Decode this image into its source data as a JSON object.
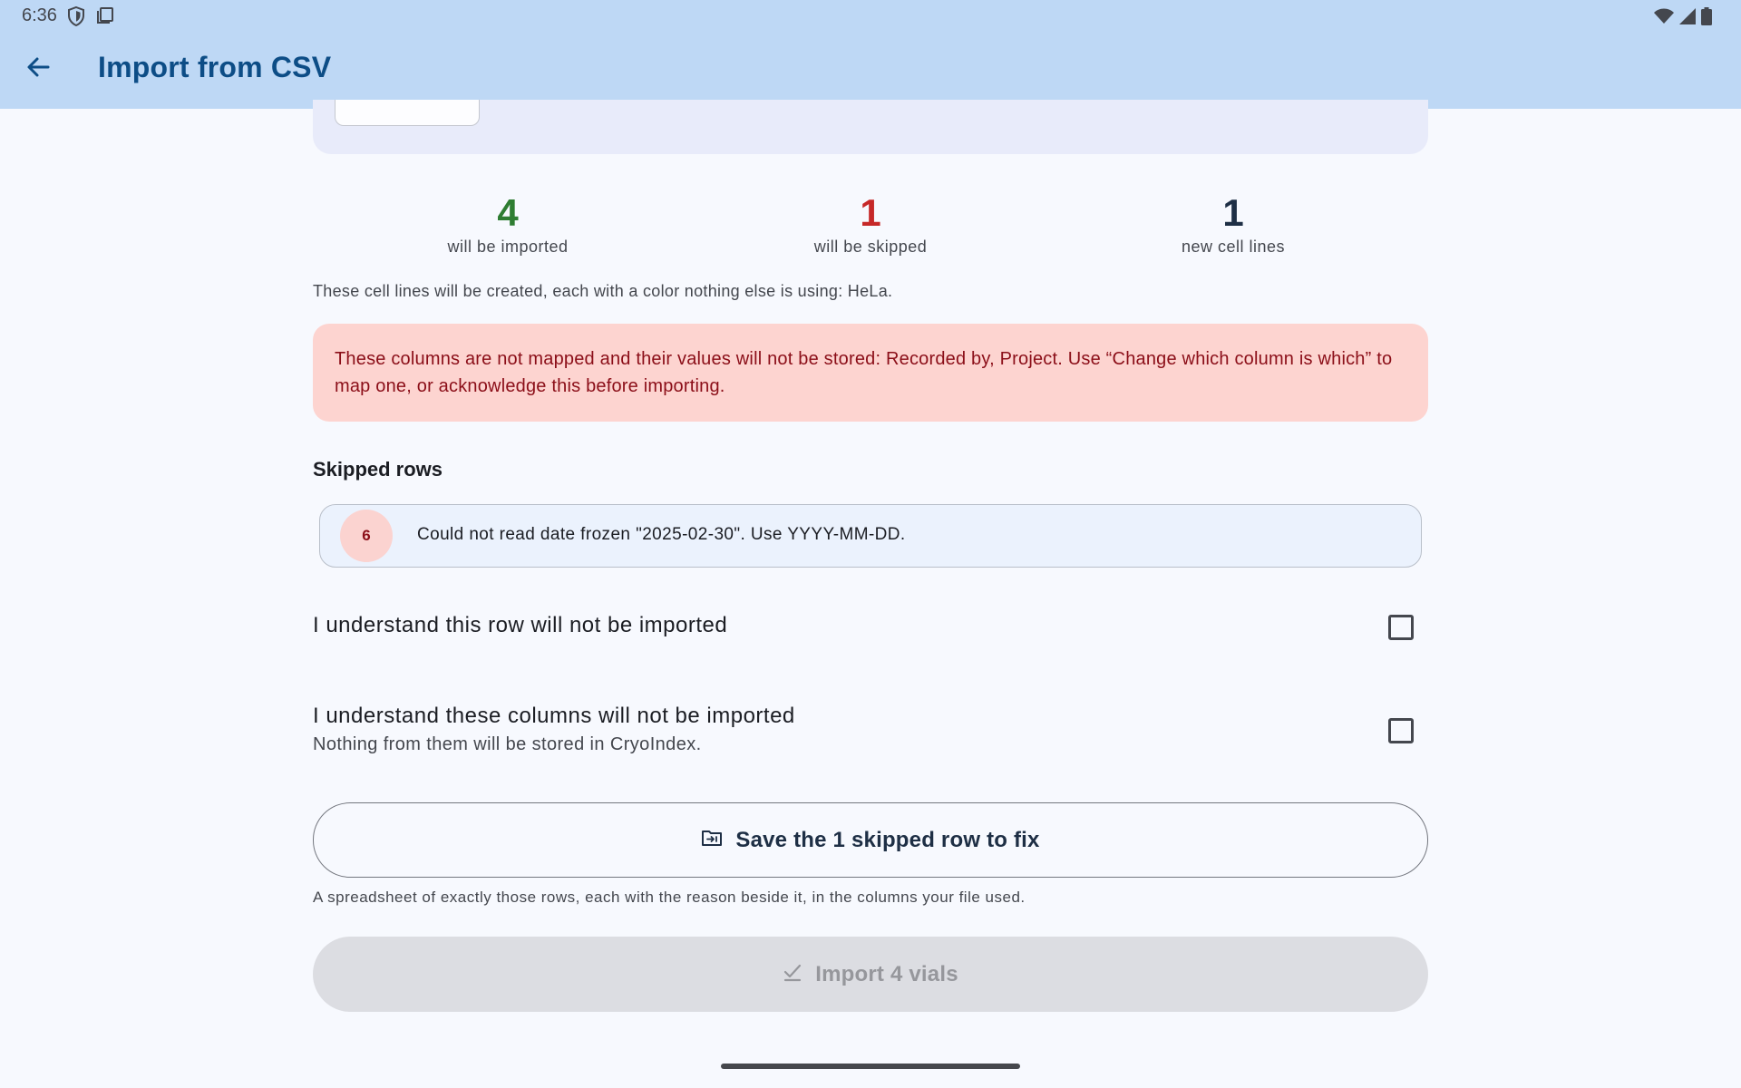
{
  "status_bar": {
    "time": "6:36",
    "left_icons": [
      "shield-icon",
      "clipboard-icon"
    ],
    "right_icons": [
      "wifi-icon",
      "signal-icon",
      "battery-icon"
    ]
  },
  "app_bar": {
    "back_icon": "arrow-back-icon",
    "title": "Import from CSV"
  },
  "stats": {
    "imported": {
      "value": "4",
      "label": "will be imported",
      "color": "#2e7d32"
    },
    "skipped": {
      "value": "1",
      "label": "will be skipped",
      "color": "#c62828"
    },
    "new_lines": {
      "value": "1",
      "label": "new cell lines",
      "color": "#1e2f45"
    }
  },
  "created_note": "These cell lines will be created, each with a color nothing else is using: HeLa.",
  "warning": {
    "text": "These columns are not mapped and their values will not be stored: Recorded by, Project. Use “Change which column is which” to map one, or acknowledge this before importing."
  },
  "skipped_section": {
    "title": "Skipped rows",
    "rows": [
      {
        "row_number": "6",
        "reason": "Could not read date frozen \"2025-02-30\". Use YYYY-MM-DD."
      }
    ]
  },
  "acknowledgements": {
    "rows": {
      "title": "I understand this row will not be imported",
      "checked": false
    },
    "columns": {
      "title": "I understand these columns will not be imported",
      "subtitle": "Nothing from them will be stored in CryoIndex.",
      "checked": false
    }
  },
  "save_button": {
    "icon": "folder-export-icon",
    "label": "Save the 1 skipped row to fix",
    "help": "A spreadsheet of exactly those rows, each with the reason beside it, in the columns your file used."
  },
  "import_button": {
    "icon": "check-icon",
    "label": "Import 4 vials",
    "enabled": false
  },
  "colors": {
    "app_bar": "#bed8f5",
    "title": "#0d4d86",
    "warning_bg": "#fdd4d0",
    "warning_text": "#8b0e18"
  }
}
